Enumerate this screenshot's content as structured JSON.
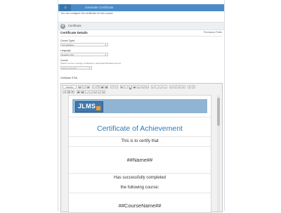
{
  "breadcrumb": {
    "home_icon": "home-icon",
    "current": "Generate Certificate"
  },
  "notice": "You can configure the certificate for this course",
  "panel": {
    "title": "Certificate",
    "icon": "gear-icon"
  },
  "section": {
    "title": "Certificate Details",
    "permission_link": "Permission Fields"
  },
  "form": {
    "course_types_label": "Course Types",
    "course_types_value": "Accreditation",
    "language_label": "Language",
    "language_value": "English (US)",
    "course_label": "Course",
    "course_help": "(Select course to assign certificate to particular/individual course)",
    "course_placeholder": "Search Courses",
    "certificate_html_label": "Certificate HTML"
  },
  "editor": {
    "source_label": "Source",
    "toolbar_row1": [
      "B",
      "I",
      "U",
      "S",
      "x₂",
      "x²",
      "Ix",
      "1.",
      "•",
      "«",
      "»",
      "≡",
      "≡",
      "≡",
      "≡",
      "¶",
      "¶"
    ],
    "toolbar_row2": [
      "🔗",
      "⛓",
      "⚑",
      "▣",
      "▦",
      "—",
      "☺",
      "Ω",
      "⎙",
      "⊞"
    ]
  },
  "certificate": {
    "logo_text": "JLMS",
    "title": "Certificate of Achievement",
    "line1": "This is to certify that",
    "name_token": "##Name##",
    "line2": "Has successfully completed",
    "line3": "the following course:",
    "course_token": "##CourseName##"
  }
}
